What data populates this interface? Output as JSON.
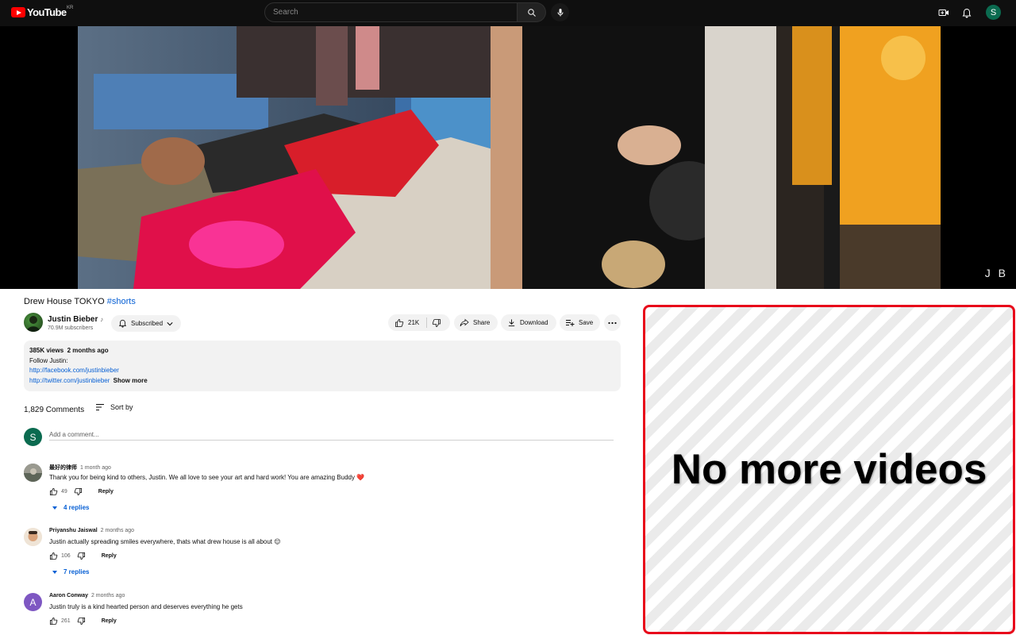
{
  "header": {
    "logo_text": "YouTube",
    "region": "KR",
    "search_placeholder": "Search",
    "avatar_letter": "S"
  },
  "video": {
    "watermark": "J B",
    "title": "Drew House TOKYO",
    "hashtag": "#shorts"
  },
  "channel": {
    "name": "Justin Bieber",
    "verified_mark": "♪",
    "subscribers": "70.9M subscribers",
    "subscribe_label": "Subscribed"
  },
  "actions": {
    "likes": "21K",
    "share": "Share",
    "download": "Download",
    "save": "Save"
  },
  "description": {
    "views": "385K views",
    "date": "2 months ago",
    "line1": "Follow Justin:",
    "link1": "http://facebook.com/justinbieber",
    "link2": "http://twitter.com/justinbieber",
    "show_more": "Show more"
  },
  "comments": {
    "count": "1,829 Comments",
    "sort_label": "Sort by",
    "my_avatar": "S",
    "add_placeholder": "Add a comment...",
    "items": [
      {
        "author": "最好的律师",
        "time": "1 month ago",
        "text": "Thank you for being kind to others, Justin. We all love to see your art and hard work! You are amazing Buddy ❤️",
        "likes": "49",
        "reply": "Reply",
        "replies": "4 replies"
      },
      {
        "author": "Priyanshu Jaiswal",
        "time": "2 months ago",
        "text": "Justin actually spreading smiles everywhere, thats what drew house is all about 😌",
        "likes": "106",
        "reply": "Reply",
        "replies": "7 replies"
      },
      {
        "author": "Aaron Conway",
        "time": "2 months ago",
        "avatar_letter": "A",
        "text": "Justin truly is a kind hearted person and deserves everything he gets",
        "likes": "261",
        "reply": "Reply"
      }
    ]
  },
  "sidebar": {
    "message": "No more videos"
  },
  "colors": {
    "accent_red": "#ff0000",
    "link_blue": "#065fd4",
    "panel_border": "#e8091a"
  }
}
